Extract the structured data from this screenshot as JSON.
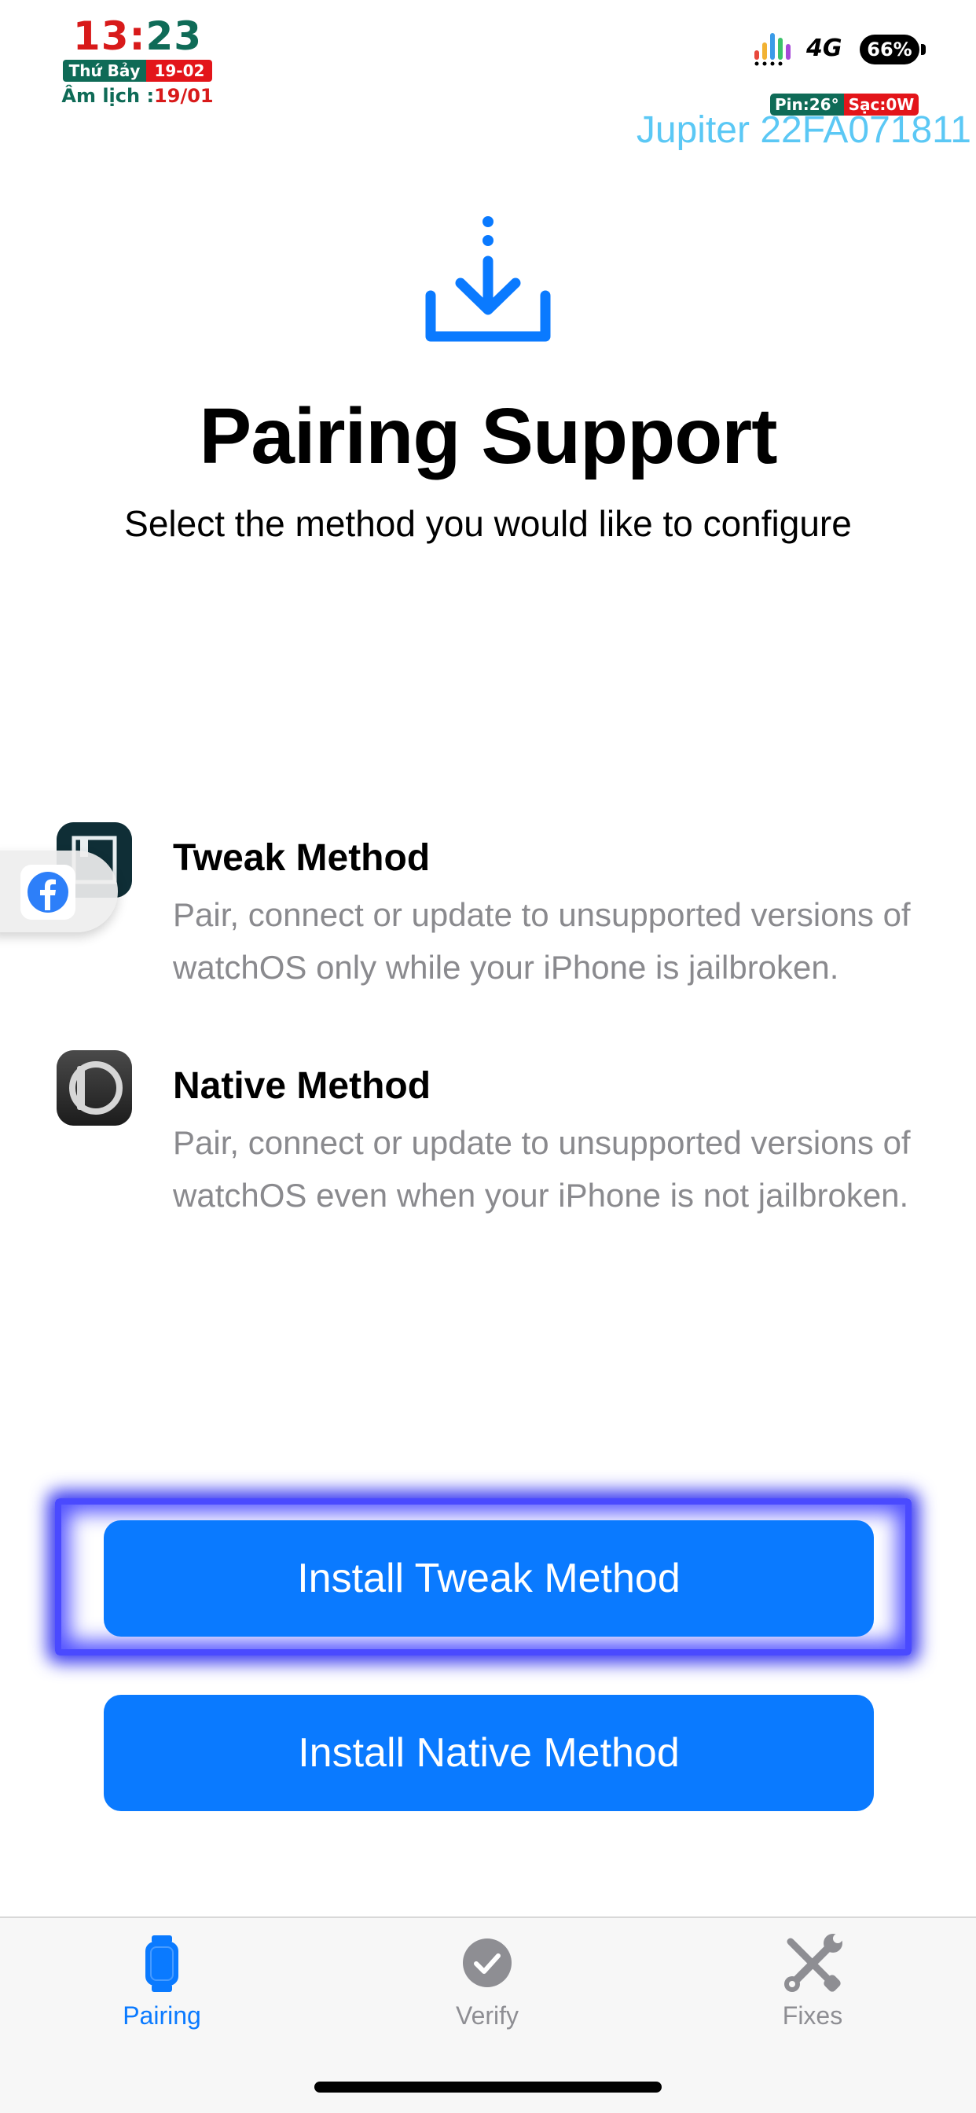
{
  "status_bar": {
    "clock_hour": "13",
    "clock_sep": ":",
    "clock_minute": "23",
    "weekday": "Thứ Bảy",
    "date": "19-02",
    "lunar_label": "Âm lịch :",
    "lunar_date": "19/01",
    "network": "4G",
    "battery": "66%",
    "pin_temp": "Pin:26°",
    "charge": "Sạc:0W",
    "device_label": "Jupiter 22FA071811"
  },
  "header": {
    "icon": "download-tray-icon",
    "title": "Pairing Support",
    "subtitle": "Select the method you would like to configure"
  },
  "methods": [
    {
      "icon": "tweak-app-icon",
      "title": "Tweak Method",
      "description": "Pair, connect or update to unsupported versions of watchOS only while your iPhone is jailbroken."
    },
    {
      "icon": "native-app-icon",
      "title": "Native Method",
      "description": "Pair, connect or update to unsupported versions of watchOS even when your iPhone is not jailbroken."
    }
  ],
  "overlay": {
    "icon": "facebook-icon"
  },
  "buttons": {
    "install_tweak": "Install Tweak Method",
    "install_native": "Install Native Method"
  },
  "tabbar": {
    "tabs": [
      {
        "label": "Pairing",
        "icon": "watch-icon",
        "active": true
      },
      {
        "label": "Verify",
        "icon": "checkmark-seal-icon",
        "active": false
      },
      {
        "label": "Fixes",
        "icon": "wrench-screwdriver-icon",
        "active": false
      }
    ]
  },
  "colors": {
    "accent": "#0a7aff",
    "secondary_text": "#8a8a8e",
    "device_label": "#5bc8f5",
    "highlight_glow": "#4a4aff"
  }
}
